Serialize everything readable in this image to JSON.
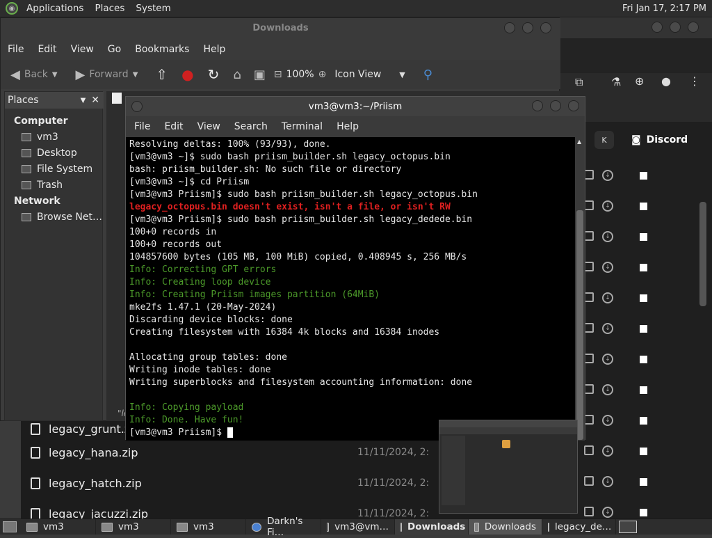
{
  "top_panel": {
    "menus": [
      "Applications",
      "Places",
      "System"
    ],
    "clock": "Fri Jan 17,  2:17 PM"
  },
  "file_manager": {
    "title": "Downloads",
    "menus": [
      "File",
      "Edit",
      "View",
      "Go",
      "Bookmarks",
      "Help"
    ],
    "toolbar": {
      "back": "Back",
      "forward": "Forward",
      "zoom": "100%",
      "view": "Icon View"
    },
    "sidebar": {
      "header": "Places",
      "computer_label": "Computer",
      "computer_items": [
        "vm3",
        "Desktop",
        "File System",
        "Trash"
      ],
      "network_label": "Network",
      "network_items": [
        "Browse Net…"
      ]
    },
    "tab_fragment": "\"le"
  },
  "terminal": {
    "title": "vm3@vm3:~/Priism",
    "menus": [
      "File",
      "Edit",
      "View",
      "Search",
      "Terminal",
      "Help"
    ],
    "lines": [
      {
        "text": "Resolving deltas: 100% (93/93), done.",
        "style": "white"
      },
      {
        "text": "[vm3@vm3 ~]$ sudo bash priism_builder.sh legacy_octopus.bin",
        "style": "white"
      },
      {
        "text": "bash: priism_builder.sh: No such file or directory",
        "style": "white"
      },
      {
        "text": "[vm3@vm3 ~]$ cd Priism",
        "style": "white"
      },
      {
        "text": "[vm3@vm3 Priism]$ sudo bash priism_builder.sh legacy_octopus.bin",
        "style": "white"
      },
      {
        "text": "legacy_octopus.bin doesn't exist, isn't a file, or isn't RW",
        "style": "red"
      },
      {
        "text": "[vm3@vm3 Priism]$ sudo bash priism_builder.sh legacy_dedede.bin",
        "style": "white"
      },
      {
        "text": "100+0 records in",
        "style": "white"
      },
      {
        "text": "100+0 records out",
        "style": "white"
      },
      {
        "text": "104857600 bytes (105 MB, 100 MiB) copied, 0.408945 s, 256 MB/s",
        "style": "white"
      },
      {
        "text": "Info: Correcting GPT errors",
        "style": "green"
      },
      {
        "text": "Info: Creating loop device",
        "style": "green"
      },
      {
        "text": "Info: Creating Priism images partition (64MiB)",
        "style": "green"
      },
      {
        "text": "mke2fs 1.47.1 (20-May-2024)",
        "style": "white"
      },
      {
        "text": "Discarding device blocks: done",
        "style": "white"
      },
      {
        "text": "Creating filesystem with 16384 4k blocks and 16384 inodes",
        "style": "white"
      },
      {
        "text": "",
        "style": "white"
      },
      {
        "text": "Allocating group tables: done",
        "style": "white"
      },
      {
        "text": "Writing inode tables: done",
        "style": "white"
      },
      {
        "text": "Writing superblocks and filesystem accounting information: done",
        "style": "white"
      },
      {
        "text": "",
        "style": "white"
      },
      {
        "text": "Info: Copying payload",
        "style": "green"
      },
      {
        "text": "Info: Done. Have fun!",
        "style": "green"
      }
    ],
    "prompt": "[vm3@vm3 Priism]$ "
  },
  "browser": {
    "discord_label": "Discord",
    "chip_label": "K"
  },
  "file_list": [
    {
      "name": "legacy_grunt.zip",
      "date": ""
    },
    {
      "name": "legacy_hana.zip",
      "date": "11/11/2024, 2:"
    },
    {
      "name": "legacy_hatch.zip",
      "date": "11/11/2024, 2:"
    },
    {
      "name": "legacy_jacuzzi.zip",
      "date": "11/11/2024, 2:"
    }
  ],
  "taskbar": {
    "items": [
      "vm3",
      "vm3",
      "vm3",
      "Darkn's Fi…",
      "vm3@vm…",
      "Downloads",
      "Downloads",
      "legacy_de…"
    ]
  },
  "colors": {
    "terminal_green": "#4c9a2a",
    "terminal_red": "#e02020",
    "panel_bg": "#2d2d2d"
  }
}
